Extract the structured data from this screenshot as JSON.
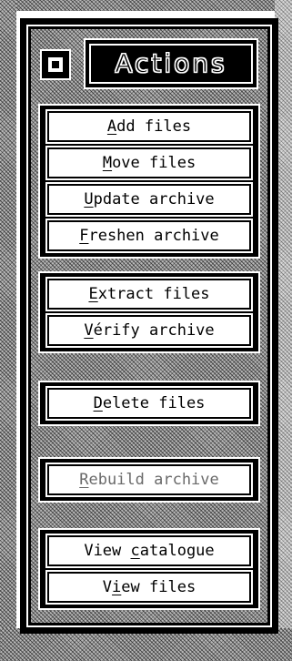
{
  "window": {
    "title": "Actions",
    "close_icon": "window-close-icon"
  },
  "groups": [
    {
      "items": [
        {
          "pre": "",
          "hk": "A",
          "post": "dd files",
          "enabled": true
        },
        {
          "pre": "",
          "hk": "M",
          "post": "ove files",
          "enabled": true
        },
        {
          "pre": "",
          "hk": "U",
          "post": "pdate archive",
          "enabled": true
        },
        {
          "pre": "",
          "hk": "F",
          "post": "reshen archive",
          "enabled": true
        }
      ]
    },
    {
      "items": [
        {
          "pre": "",
          "hk": "E",
          "post": "xtract files",
          "enabled": true
        },
        {
          "pre": "",
          "hk": "V",
          "post": "érify archive",
          "enabled": true
        }
      ]
    },
    {
      "items": [
        {
          "pre": "",
          "hk": "D",
          "post": "elete files",
          "enabled": true
        }
      ]
    },
    {
      "items": [
        {
          "pre": "",
          "hk": "R",
          "post": "ebuild archive",
          "enabled": false
        }
      ]
    },
    {
      "items": [
        {
          "pre": "View ",
          "hk": "c",
          "post": "atalogue",
          "enabled": true
        },
        {
          "pre": "V",
          "hk": "i",
          "post": "ew files",
          "enabled": true
        }
      ]
    }
  ],
  "colors": {
    "background": "#000000",
    "button_face": "#ffffff",
    "disabled_text": "#6a6a6a",
    "desktop_pattern": "#b8b8b8"
  }
}
